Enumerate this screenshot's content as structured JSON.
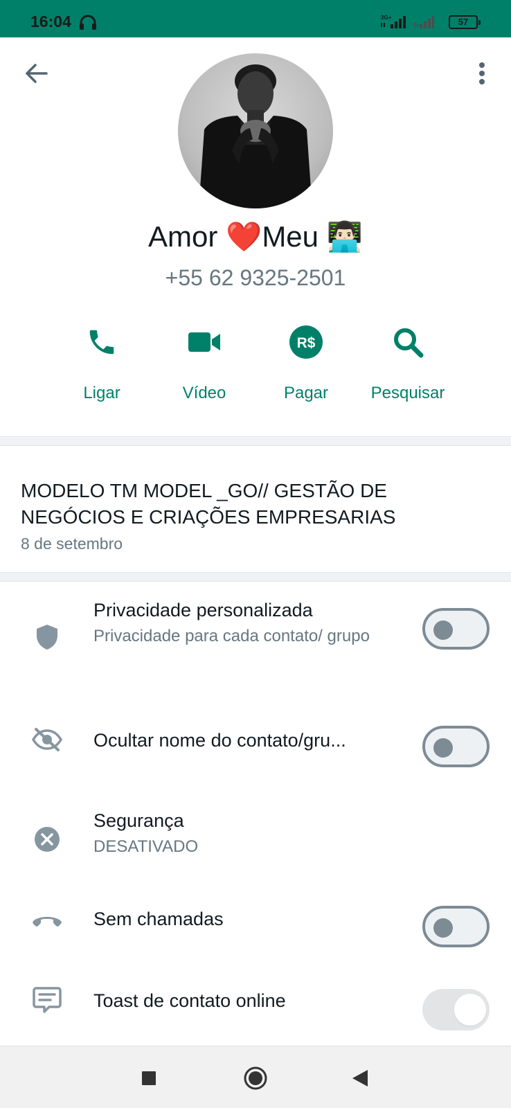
{
  "status_bar": {
    "time": "16:04",
    "network": "3G+",
    "battery": "57"
  },
  "header": {
    "back_icon": "arrow-back-icon",
    "menu_icon": "more-vert-icon"
  },
  "contact": {
    "name_part1": "Amor ",
    "name_heart": "❤️",
    "name_part2": "Meu ",
    "name_emoji": "👨🏻‍💻",
    "phone": "+55 62 9325-2501"
  },
  "actions": [
    {
      "label": "Ligar",
      "icon": "phone-icon"
    },
    {
      "label": "Vídeo",
      "icon": "video-icon"
    },
    {
      "label": "Pagar",
      "icon": "pay-icon",
      "icon_text": "R$"
    },
    {
      "label": "Pesquisar",
      "icon": "search-icon"
    }
  ],
  "about": {
    "text": "MODELO TM MODEL  _GO// GESTÃO DE NEGÓCIOS E CRIAÇÕES EMPRESARIAS",
    "date": "8 de setembro"
  },
  "settings": [
    {
      "title": "Privacidade personalizada",
      "subtitle": "Privacidade para cada contato/ grupo",
      "icon": "shield-icon",
      "toggle": "off"
    },
    {
      "title": "Ocultar nome do contato/gru...",
      "icon": "eye-off-icon",
      "toggle": "off"
    },
    {
      "title": "Segurança",
      "subtitle": "DESATIVADO",
      "icon": "close-circle-icon"
    },
    {
      "title": "Sem chamadas",
      "icon": "call-end-icon",
      "toggle": "off"
    },
    {
      "title": "Toast de contato online",
      "icon": "message-icon",
      "toggle": "on-disabled"
    }
  ],
  "colors": {
    "accent": "#008069",
    "status_bar": "#008069",
    "secondary_text": "#667781",
    "icon_gray": "#8696a0"
  },
  "navbar": {
    "recent_icon": "square-icon",
    "home_icon": "circle-home-icon",
    "back_icon": "triangle-back-icon"
  }
}
